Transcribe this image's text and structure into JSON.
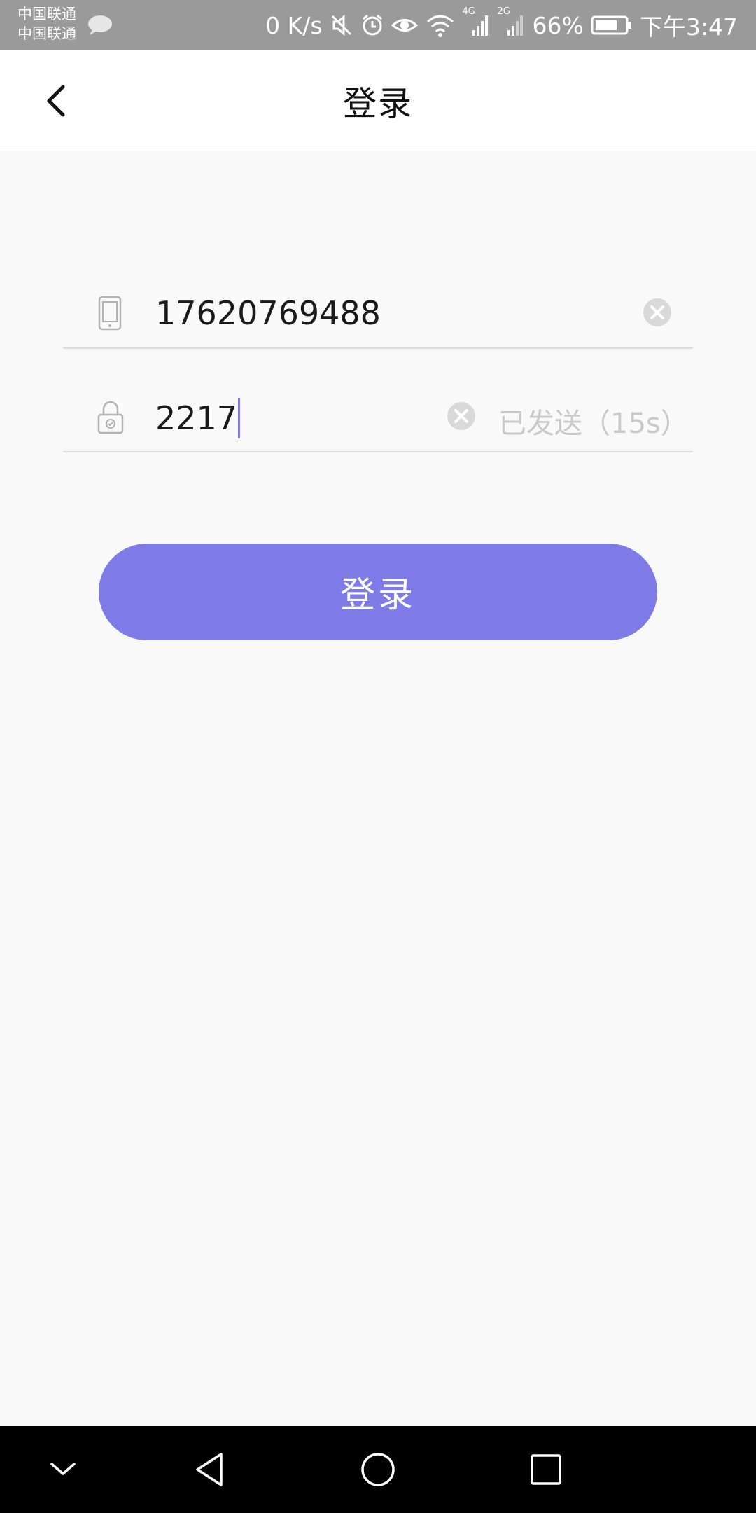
{
  "status_bar": {
    "carrier_1": "中国联通",
    "carrier_2": "中国联通",
    "network_speed": "0 K/s",
    "signal_1_tech": "4G",
    "signal_2_tech": "2G",
    "battery_percent": "66%",
    "time": "下午3:47",
    "icons": [
      "chat-bubble-icon",
      "mute-icon",
      "alarm-icon",
      "eye-icon",
      "wifi-icon",
      "signal-icon",
      "battery-icon"
    ]
  },
  "header": {
    "title": "登录",
    "back_icon": "chevron-left-icon"
  },
  "form": {
    "phone": {
      "icon": "phone-icon",
      "value": "17620769488",
      "clear_icon": "clear-circle-icon"
    },
    "code": {
      "icon": "lock-icon",
      "value": "2217",
      "clear_icon": "clear-circle-icon",
      "countdown_label": "已发送（15s）"
    }
  },
  "login_button": {
    "label": "登录"
  },
  "nav_bar": {
    "icons": [
      "chevron-down-icon",
      "triangle-back-icon",
      "circle-home-icon",
      "square-recent-icon"
    ]
  },
  "colors": {
    "accent": "#7e7ae8",
    "status_bar": "#9a9a9a",
    "background": "#f9f9f9",
    "nav_bar": "#000000"
  }
}
